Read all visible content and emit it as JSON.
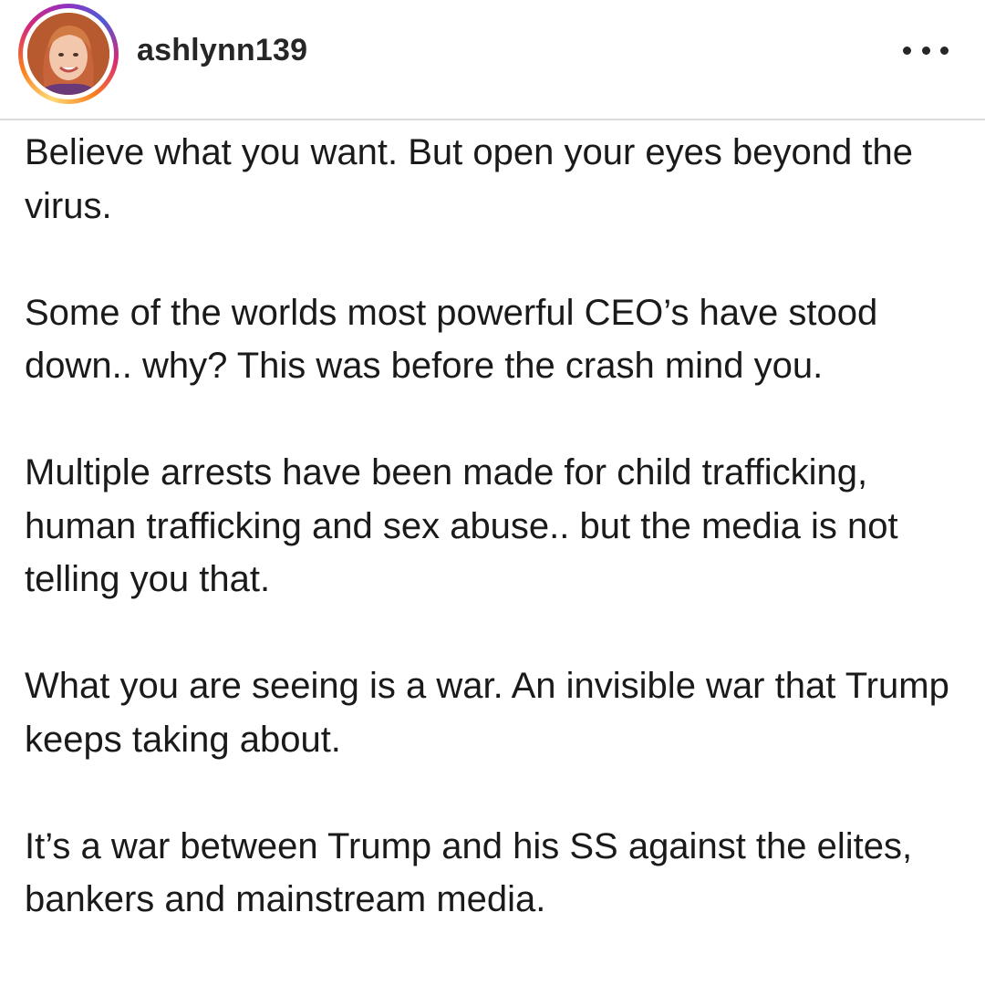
{
  "post": {
    "username": "ashlynn139",
    "avatar_icon": "profile-photo",
    "more_icon": "more-options-icon",
    "accent_ring_colors": [
      "#feda75",
      "#fa7e1e",
      "#d62976",
      "#962fbf",
      "#4f5bd5"
    ]
  },
  "caption": {
    "paragraphs": [
      "Believe what you want. But open your eyes beyond the virus.",
      "Some of the worlds most powerful CEO’s have stood down.. why? This was before the crash mind you.",
      "Multiple arrests have been made for child trafficking, human trafficking and sex abuse.. but the media is not telling you that.",
      "What you are seeing is a war. An invisible war that Trump keeps taking about.",
      "It’s a war between Trump and his SS against the elites, bankers and mainstream media."
    ]
  }
}
